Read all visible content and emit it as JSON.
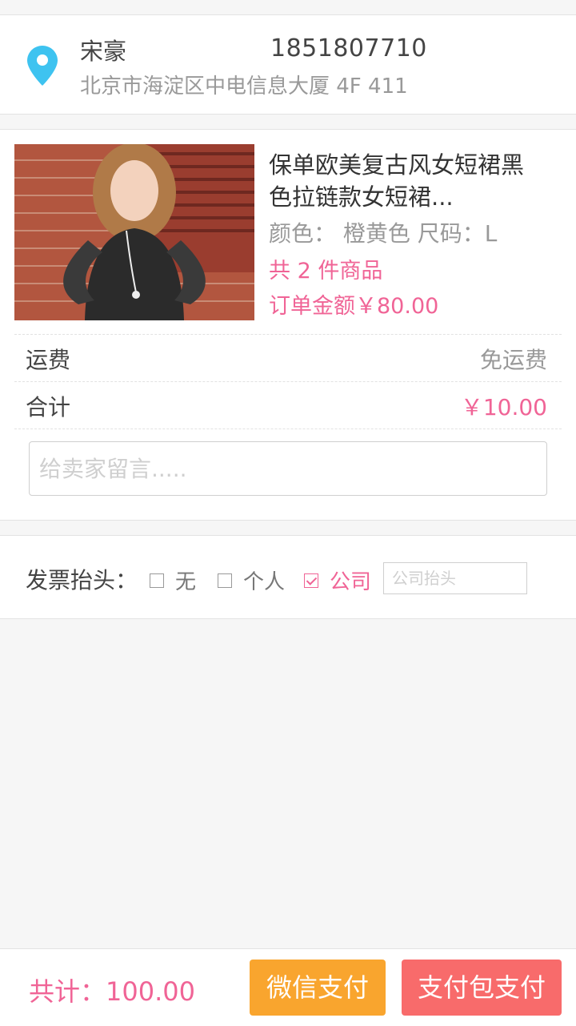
{
  "address": {
    "name": "宋豪",
    "phone": "1851807710",
    "detail": "北京市海淀区中电信息大厦 4F 411",
    "icon": "location-pin-icon",
    "icon_color": "#3ec3f0"
  },
  "order": {
    "product": {
      "title_line1": "保单欧美复古风女短裙黑",
      "title_line2": "色拉链款女短裙...",
      "spec": "颜色： 橙黄色  尺码：L",
      "count": "共 2 件商品",
      "amount": "订单金额￥80.00"
    },
    "freight": {
      "label": "运费",
      "value": "免运费"
    },
    "total": {
      "label": "合计",
      "value": "￥10.00"
    },
    "message_placeholder": "给卖家留言....."
  },
  "invoice": {
    "label": "发票抬头：",
    "options": [
      {
        "label": "无",
        "checked": false
      },
      {
        "label": "个人",
        "checked": false
      },
      {
        "label": "公司",
        "checked": true
      }
    ],
    "company_placeholder": "公司抬头"
  },
  "footer": {
    "grand_total": "共计：100.00",
    "wechat_pay": "微信支付",
    "alipay_pay": "支付包支付"
  },
  "colors": {
    "accent": "#f06496",
    "wechat_button": "#f9a52e",
    "alipay_button": "#f86b6b"
  }
}
